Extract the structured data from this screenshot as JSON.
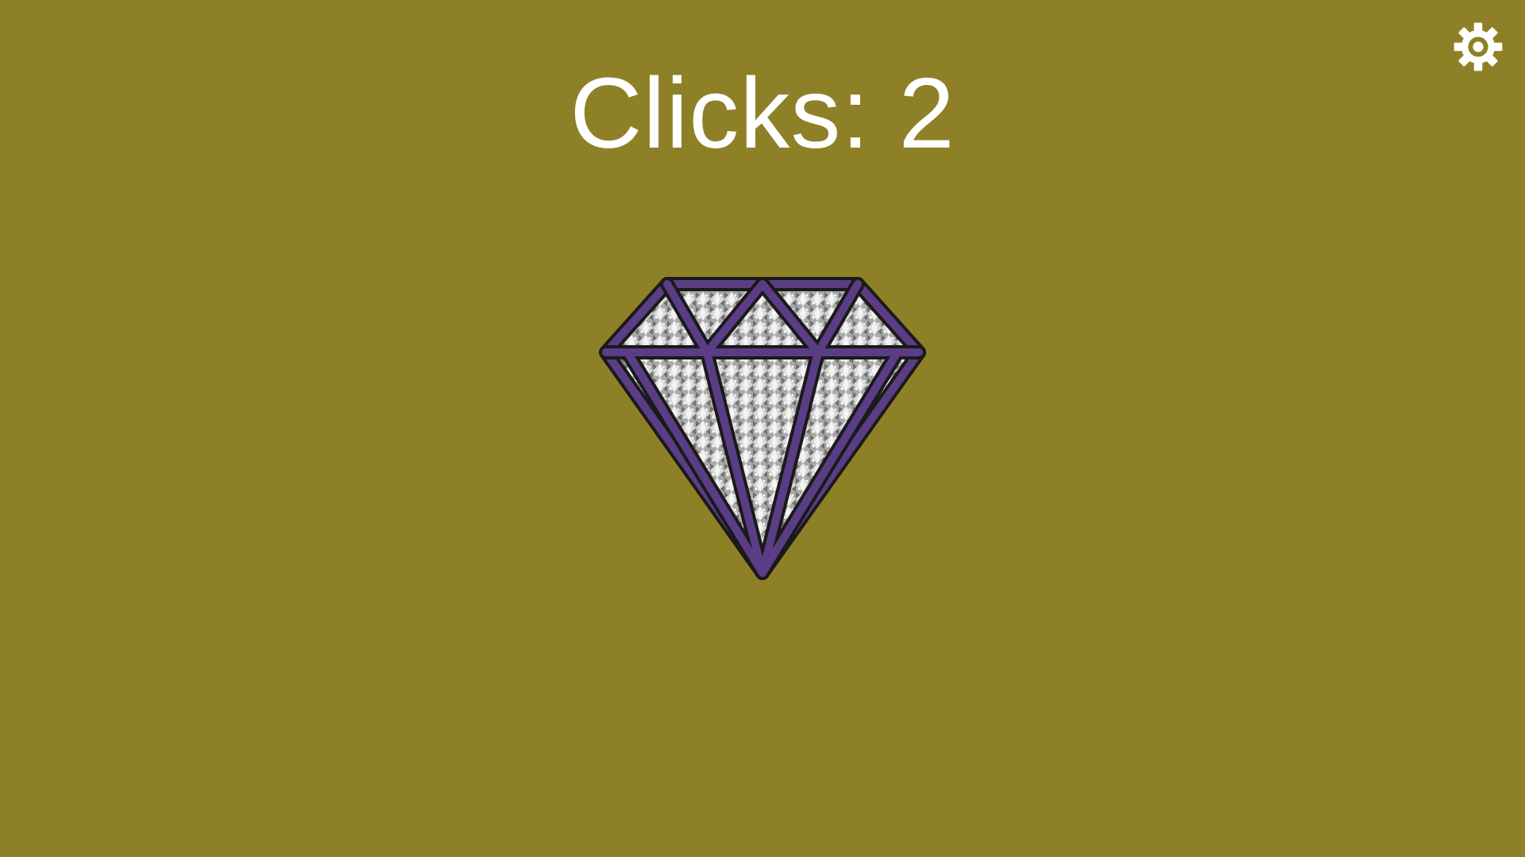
{
  "game": {
    "clicks_text": "Clicks: 2",
    "clicks_count": 2
  },
  "icons": {
    "settings": "gear-icon",
    "clicker": "diamond-icon"
  },
  "colors": {
    "background": "#8e8027",
    "text": "#ffffff",
    "diamond_outline": "#5b3d86",
    "diamond_fill": "#b8b8b8"
  }
}
